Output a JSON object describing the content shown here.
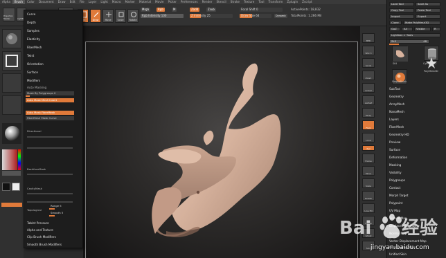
{
  "menu": [
    "Alpha",
    "Brush",
    "Color",
    "Document",
    "Draw",
    "Edit",
    "File",
    "Layer",
    "Light",
    "Macro",
    "Marker",
    "Material",
    "Movie",
    "Picker",
    "Preferences",
    "Render",
    "Stencil",
    "Stroke",
    "Texture",
    "Tool",
    "Transform",
    "Zplugin",
    "Zscript"
  ],
  "toolbar": {
    "projection_master": "Projection Master",
    "lightbox": "LightBox",
    "quick_sketch": "Quick Sketch",
    "edit": "Edit",
    "draw": "Draw",
    "move": "Move",
    "scale": "Scale",
    "rotate": "Rotate",
    "mrgb": "Mrgb",
    "rgb": "Rgb",
    "m": "M",
    "rgb_intensity": "Rgb Intensity 100",
    "zadd": "Zadd",
    "zsub": "Zsub",
    "z_intensity": "Z Intensity 25",
    "focal_shift": "Focal Shift 0",
    "draw_size": "Draw Size 64",
    "dynamic": "Dynamic",
    "active_points": "ActivePoints: 18,832",
    "total_points": "TotalPoints: 1.266 Mil"
  },
  "brush_menu": {
    "items": [
      "Curve",
      "Depth",
      "Samples",
      "Elasticity",
      "FiberMesh",
      "Twist",
      "Orientation",
      "Surface",
      "Modifiers"
    ],
    "auto_masking": "Auto Masking",
    "mask_by_polygroups": "Mask By Polygroups 0",
    "auto_mask_mesh_insert": "Auto Mask Mesh Insert",
    "auto_mask_fibermesh": "Auto Mask FiberMesh",
    "fibermesh_mask_curve": "FiberMesh Mask Curve",
    "directional": "Directional",
    "backfacemask": "BackfaceMask",
    "cavitymask": "CavityMask",
    "topological": "Topological",
    "range": "Range 5",
    "smooth": "Smooth 5",
    "footer": [
      "Tablet Pressure",
      "Alpha and Texture",
      "Clip Brush Modifiers",
      "Smooth Brush Modifiers"
    ]
  },
  "right_strip": [
    "BPR",
    "SPix 3",
    "Scroll",
    "Zoom",
    "Actual",
    "AAHalf",
    "Persp",
    "Floor",
    "Local",
    "L.Sym",
    "Xyz",
    "Frame",
    "Move",
    "Scale",
    "Rotate",
    "Line Fill",
    "Transp",
    "Ghost",
    "Solo",
    "Xpose"
  ],
  "tool_palette": {
    "buttons": [
      "Load Tool",
      "Save As",
      "Copy Tool",
      "Paste Tool",
      "Import",
      "Export",
      "Clone",
      "Make PolyMesh3D",
      "GoZ",
      "All",
      "Visible",
      "R"
    ],
    "lightbox_tools": "Lightbox > Tools",
    "tool_name": "Sk5",
    "tool_count": "48",
    "thumbs": [
      "Sk5",
      "Cylinder3D",
      "PolyMesh3D",
      "SimpleBrush"
    ],
    "sections": [
      "SubTool",
      "Geometry",
      "ArrayMesh",
      "NanoMesh",
      "Layers",
      "FiberMesh",
      "Geometry HD",
      "Preview",
      "Surface",
      "Deformation",
      "Masking",
      "Visibility",
      "Polygroups",
      "Contact",
      "Morph Target",
      "Polypaint",
      "UV Map",
      "Texture Map",
      "Displacement Map",
      "Normal Map",
      "Vector Displacement Map",
      "Display Properties",
      "Unified Skin"
    ]
  },
  "watermark": {
    "site": "jingyan.baidu.com",
    "logo_text": "Baidu"
  },
  "colors": {
    "accent": "#e07a3a",
    "model": "#d8b39e"
  }
}
